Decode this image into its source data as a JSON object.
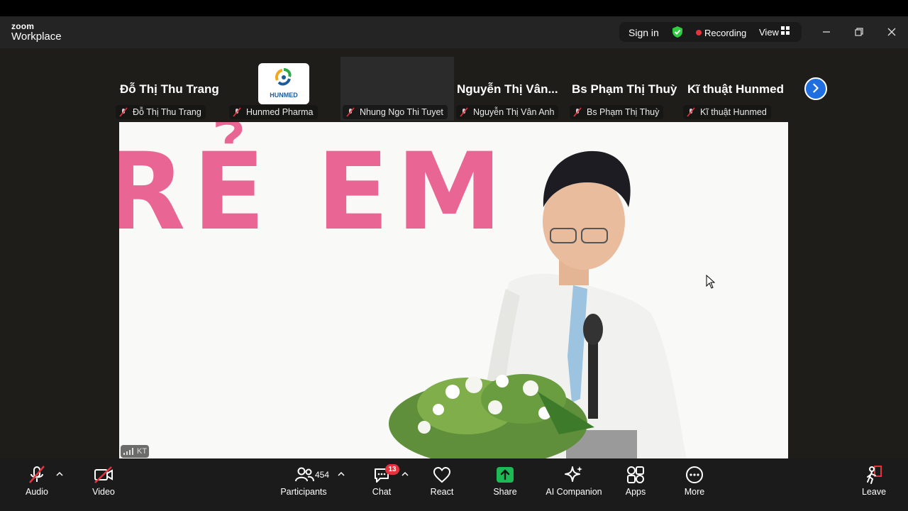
{
  "titlebar": {
    "brand_top": "zoom",
    "brand_bottom": "Workplace",
    "sign_in": "Sign in",
    "recording": "Recording",
    "view": "View"
  },
  "participants_strip": {
    "big_names": [
      "Đỗ Thị Thu Trang",
      "Nguyễn  Thị  Vân...",
      "Bs Phạm Thị Thuỳ",
      "Kĩ thuật Hunmed"
    ],
    "labels": [
      "Đỗ Thị Thu Trang",
      "Hunmed Pharma",
      "Nhung Ngo Thi Tuyet",
      "Nguyễn Thị Vân Anh",
      "Bs Phạm Thị Thuỳ",
      "Kĩ thuật Hunmed"
    ],
    "logo_text": "HUNMED"
  },
  "main_video": {
    "banner_text": "RẺ EM",
    "participant_initials": "KT"
  },
  "toolbar": {
    "audio": "Audio",
    "video": "Video",
    "participants": "Participants",
    "participant_count": "454",
    "chat": "Chat",
    "chat_badge": "13",
    "react": "React",
    "share": "Share",
    "ai_companion": "AI Companion",
    "apps": "Apps",
    "more": "More",
    "leave": "Leave"
  },
  "colors": {
    "share_green": "#1db954",
    "recording_red": "#e5323d",
    "next_blue": "#1f6fe0",
    "shield_green": "#2ecc40"
  }
}
